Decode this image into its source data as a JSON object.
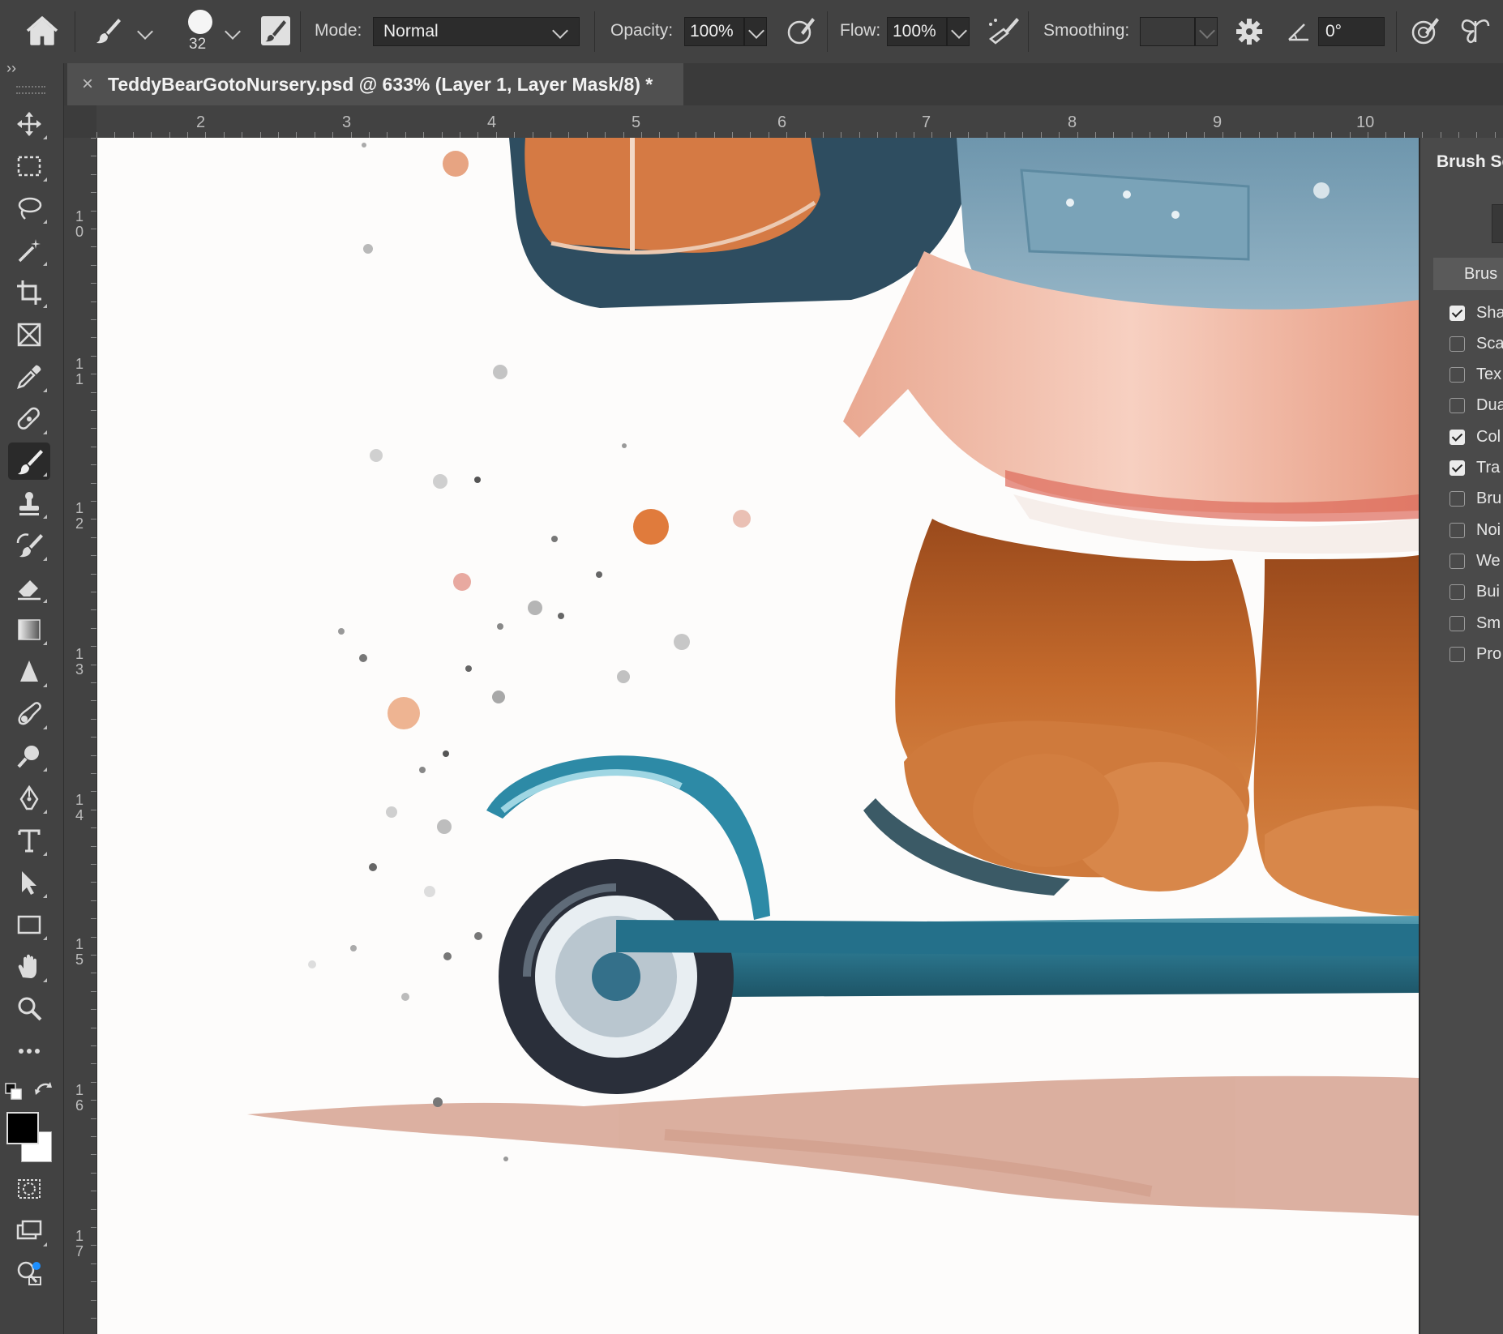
{
  "options_bar": {
    "brush_size": "32",
    "mode_label": "Mode:",
    "mode_value": "Normal",
    "opacity_label": "Opacity:",
    "opacity_value": "100%",
    "flow_label": "Flow:",
    "flow_value": "100%",
    "smoothing_label": "Smoothing:",
    "smoothing_value": "",
    "angle_value": "0°"
  },
  "document": {
    "tab_title": "TeddyBearGotoNursery.psd @ 633% (Layer 1, Layer Mask/8) *",
    "close_glyph": "×"
  },
  "rulers": {
    "horizontal": [
      "2",
      "3",
      "4",
      "5",
      "6",
      "7",
      "8",
      "9",
      "10"
    ],
    "vertical": [
      "10",
      "11",
      "12",
      "13",
      "14",
      "15",
      "16",
      "17"
    ]
  },
  "toolbar": {
    "collapse_glyph": "››",
    "tools": [
      "move",
      "marquee",
      "lasso",
      "magic-wand",
      "crop",
      "frame",
      "eyedropper",
      "healing-brush",
      "brush",
      "clone-stamp",
      "history-brush",
      "eraser",
      "gradient",
      "blur",
      "smudge",
      "dodge",
      "pen",
      "type",
      "path-selection",
      "rectangle",
      "hand",
      "zoom",
      "more"
    ],
    "active_tool": "brush",
    "foreground_color": "#000000",
    "background_color": "#ffffff"
  },
  "brush_settings_panel": {
    "title": "Brush Se",
    "header": "Brus",
    "items": [
      {
        "label": "Sha",
        "checked": true
      },
      {
        "label": "Sca",
        "checked": false
      },
      {
        "label": "Tex",
        "checked": false
      },
      {
        "label": "Dua",
        "checked": false
      },
      {
        "label": "Col",
        "checked": true
      },
      {
        "label": "Tra",
        "checked": true
      },
      {
        "label": "Bru",
        "checked": false
      },
      {
        "label": "Noi",
        "checked": false
      },
      {
        "label": "We",
        "checked": false
      },
      {
        "label": "Bui",
        "checked": false
      },
      {
        "label": "Sm",
        "checked": false
      },
      {
        "label": "Pro",
        "checked": false
      }
    ]
  },
  "colors": {
    "ui_dark": "#424242",
    "ui_darker": "#2c2c2c",
    "scooter_teal": "#2e7f97",
    "bear_fur": "#c06a2e",
    "skirt_pink": "#f0b7a4"
  }
}
